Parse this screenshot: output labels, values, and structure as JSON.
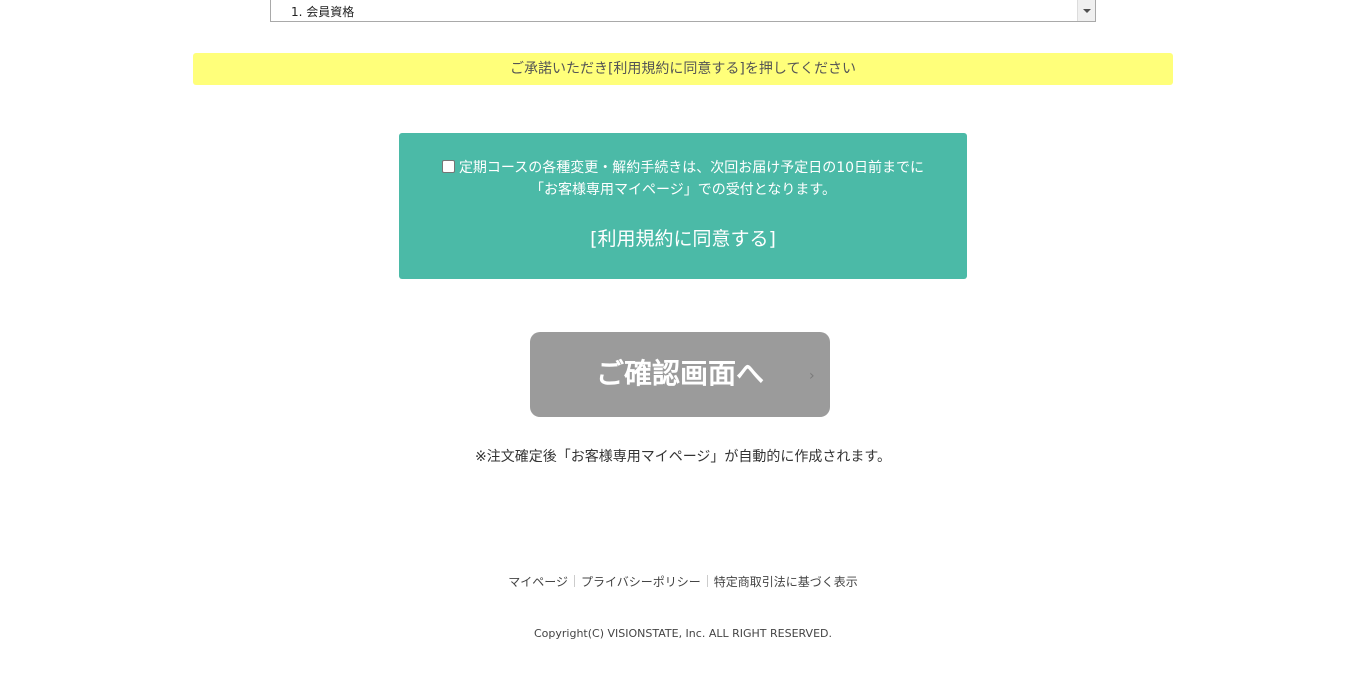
{
  "terms": {
    "visible_text": "1. 会員資格"
  },
  "notice": {
    "text": "ご承諾いただき[利用規約に同意する]を押してください"
  },
  "agree": {
    "line1": "定期コースの各種変更・解約手続きは、次回お届け予定日の10日前までに",
    "line2": "「お客様専用マイページ」での受付となります。",
    "link": "[利用規約に同意する]",
    "checked": false
  },
  "confirm": {
    "label": "ご確認画面へ",
    "chevron": "›"
  },
  "note": {
    "text": "※注文確定後「お客様専用マイページ」が自動的に作成されます。"
  },
  "footer": {
    "links": [
      "マイページ",
      "プライバシーポリシー",
      "特定商取引法に基づく表示"
    ],
    "copyright": "Copyright(C) VISIONSTATE, Inc. ALL RIGHT RESERVED."
  },
  "colors": {
    "notice_bg": "#ffff7a",
    "agree_bg": "#4bbaa7",
    "confirm_bg": "#9b9b9b"
  }
}
